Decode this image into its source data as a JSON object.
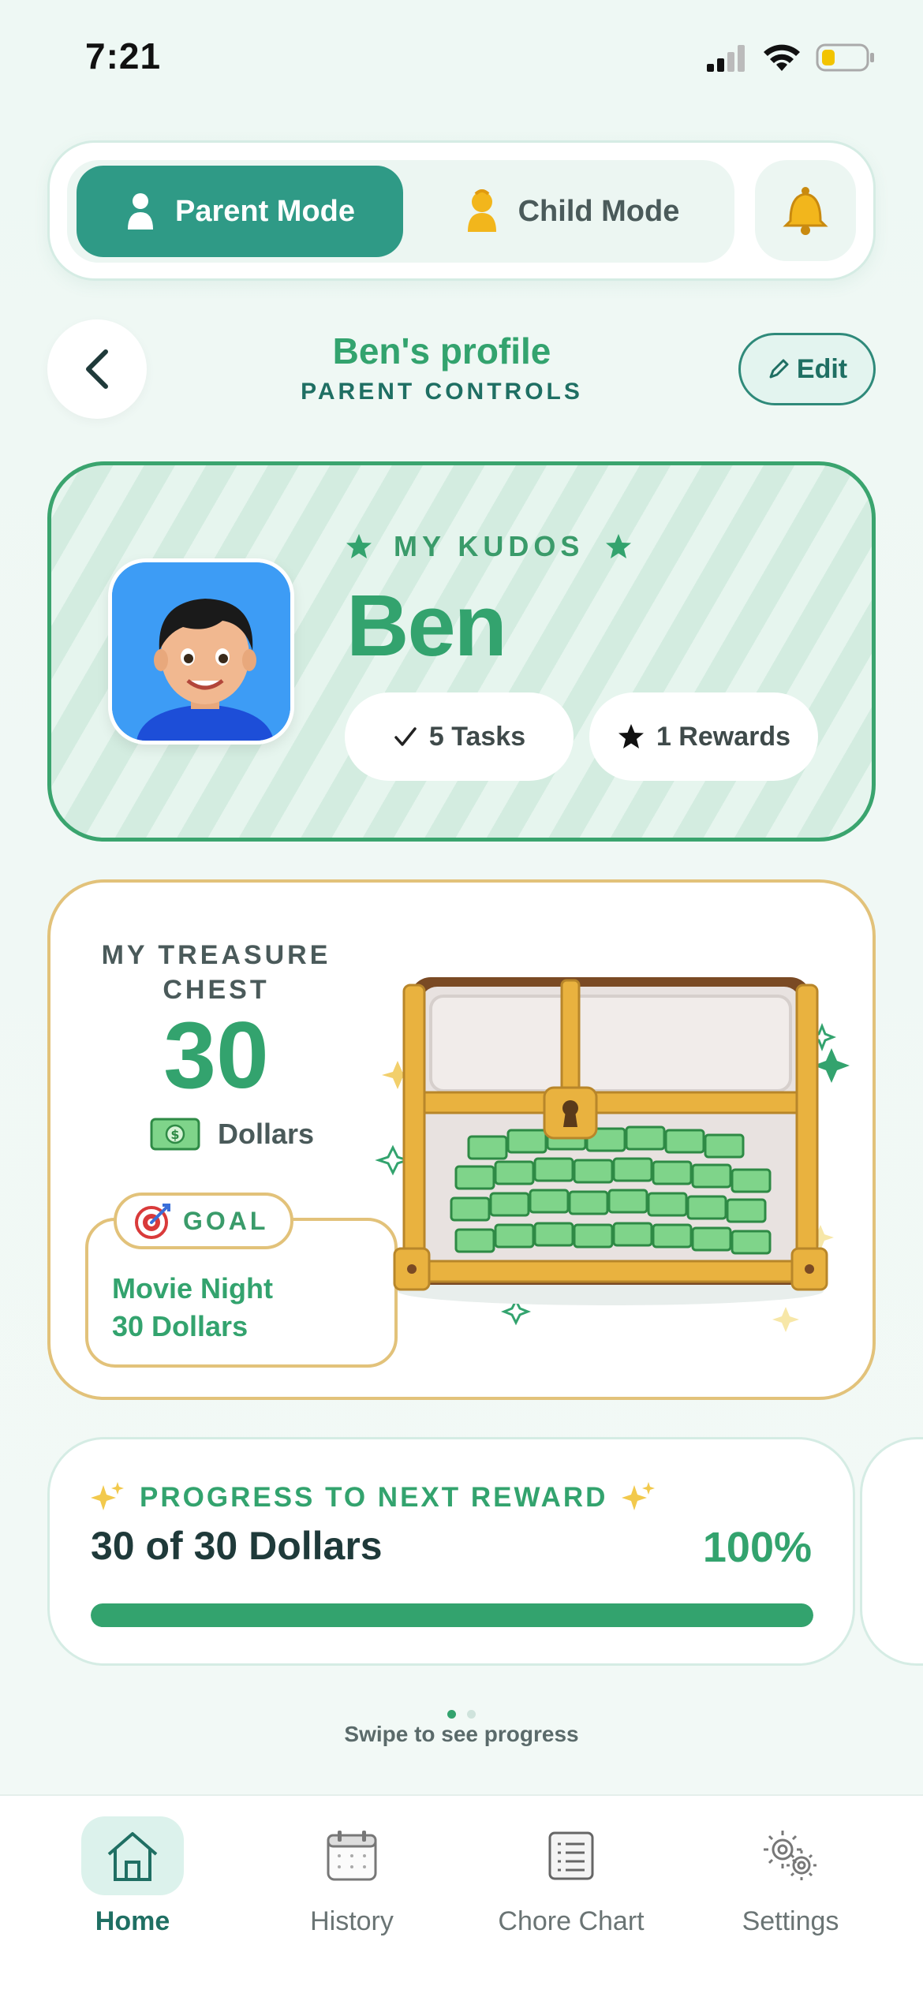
{
  "status_bar": {
    "time": "7:21"
  },
  "mode_switch": {
    "parent_label": "Parent Mode",
    "child_label": "Child Mode",
    "active": "parent",
    "notification_icon": "bell-icon"
  },
  "header": {
    "title": "Ben's profile",
    "subtitle": "PARENT CONTROLS",
    "edit_label": "Edit"
  },
  "kudos": {
    "label": "MY KUDOS",
    "name": "Ben",
    "tasks": "5 Tasks",
    "rewards": "1 Rewards"
  },
  "treasure": {
    "title": "MY TREASURE CHEST",
    "amount": "30",
    "unit": "Dollars",
    "goal_tag": "GOAL",
    "goal_line1": "Movie Night",
    "goal_line2": "30 Dollars"
  },
  "progress": {
    "label": "PROGRESS TO NEXT REWARD",
    "value_text": "30 of 30 Dollars",
    "percent_text": "100%",
    "fraction": 1.0
  },
  "pager": {
    "hint": "Swipe to see progress",
    "pages": 2,
    "current": 0
  },
  "tabs": [
    {
      "label": "Home",
      "icon": "home-icon",
      "active": true
    },
    {
      "label": "History",
      "icon": "calendar-icon",
      "active": false
    },
    {
      "label": "Chore Chart",
      "icon": "list-icon",
      "active": false
    },
    {
      "label": "Settings",
      "icon": "gear-icon",
      "active": false
    }
  ],
  "colors": {
    "accent": "#33a36e",
    "teal": "#2f9a86",
    "gold": "#e2c27a",
    "background": "#eef8f4"
  }
}
